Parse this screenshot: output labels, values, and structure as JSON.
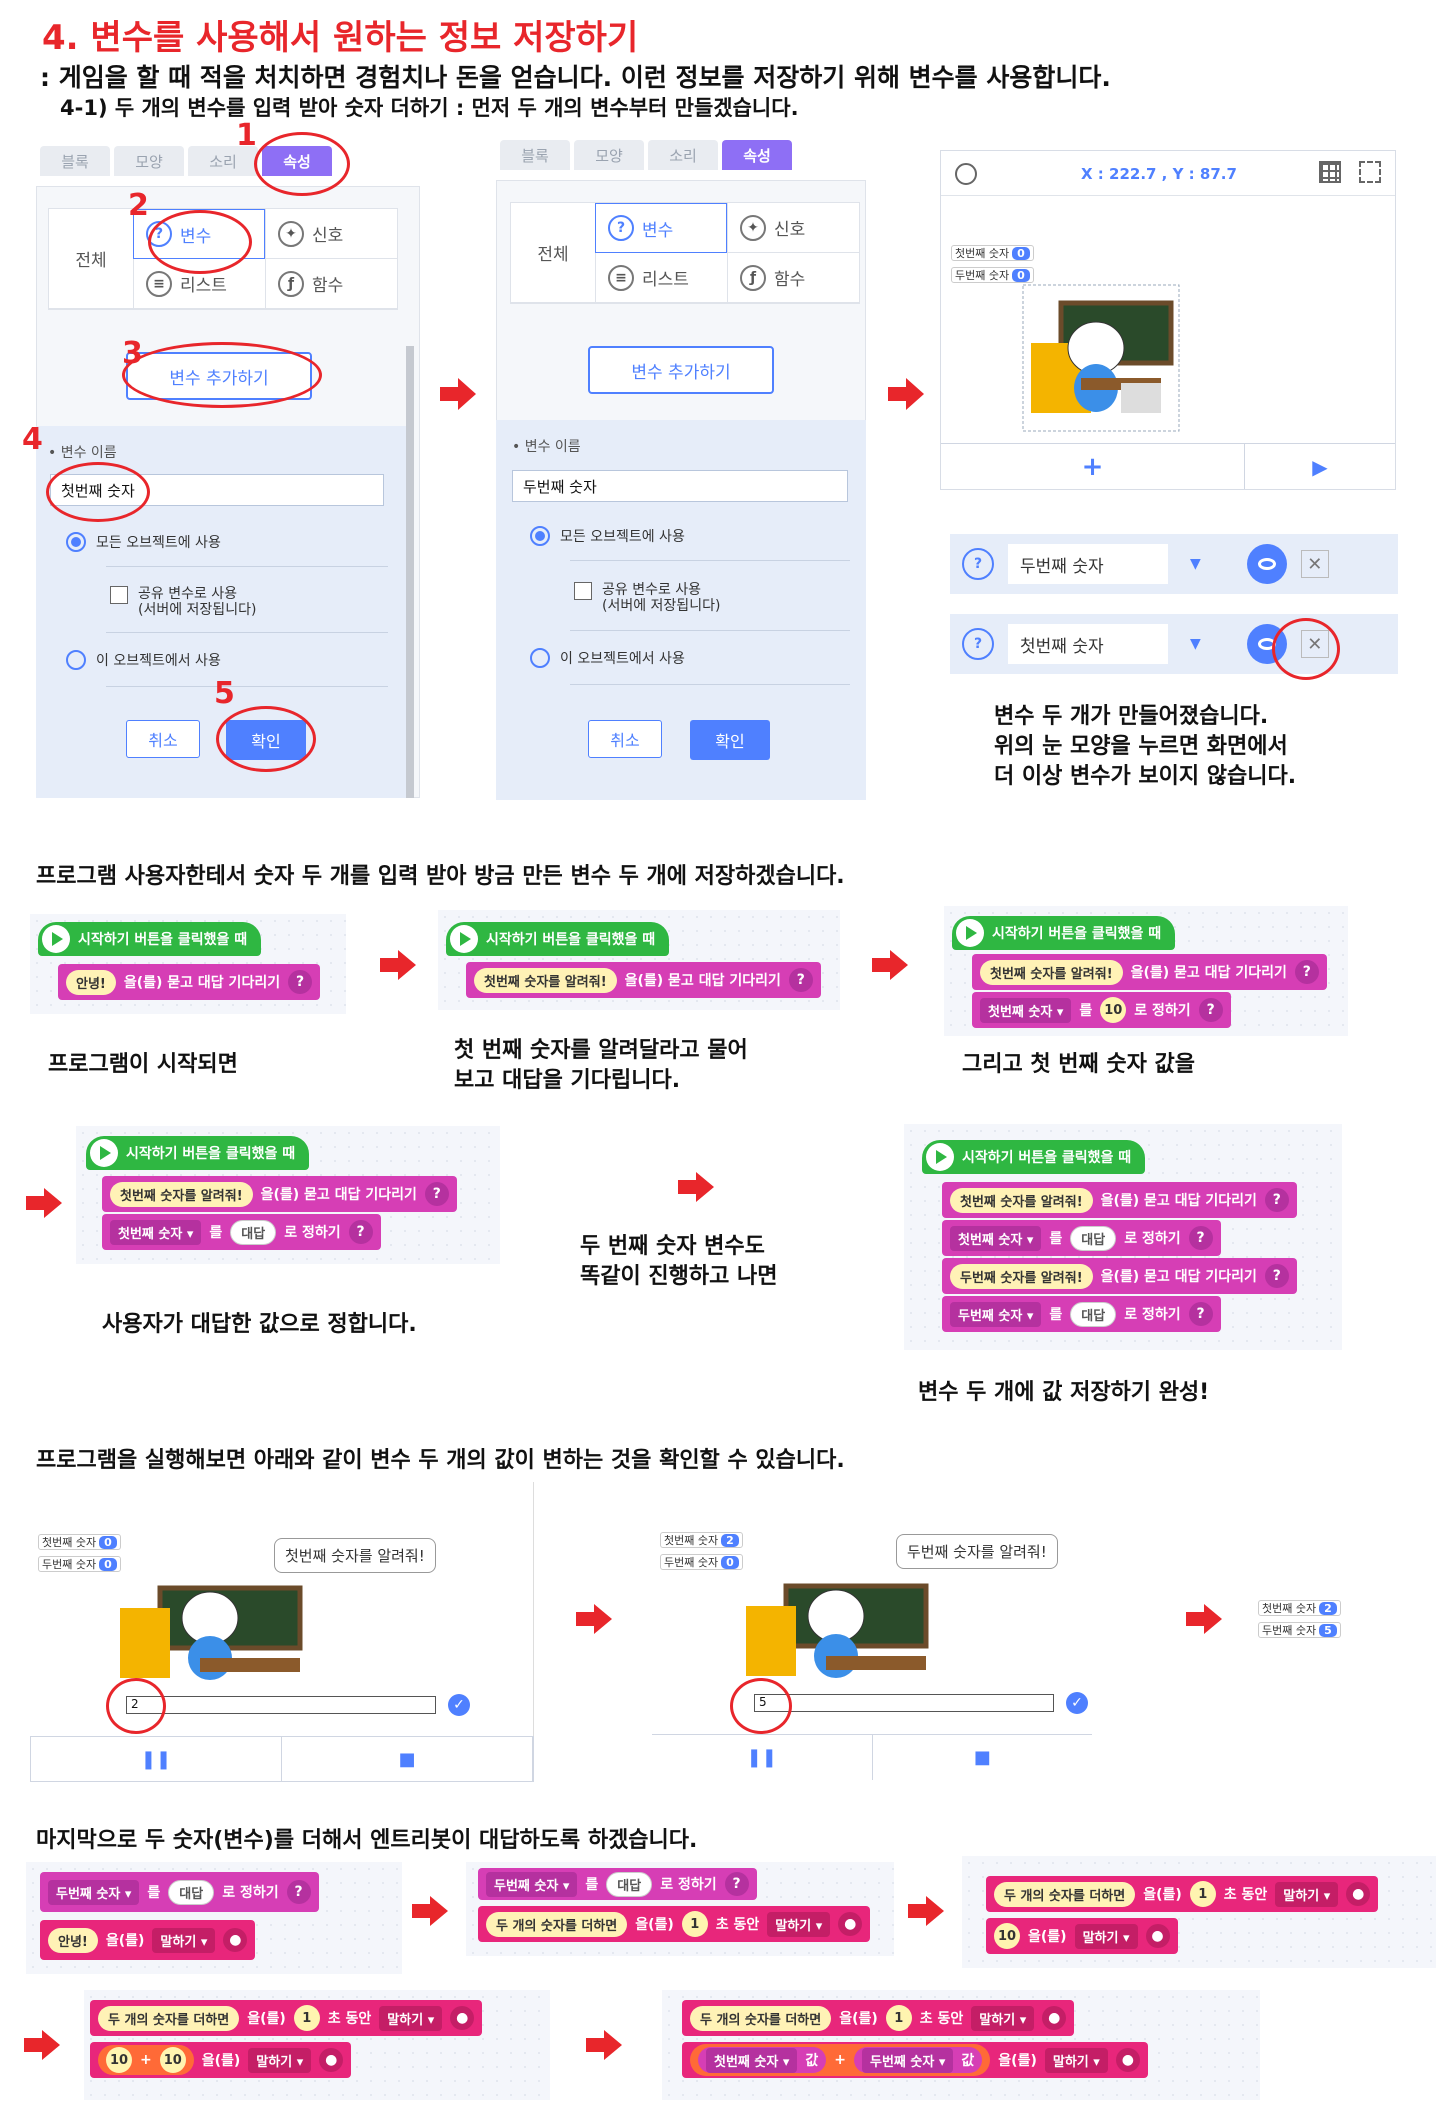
{
  "title": "4. 변수를 사용해서 원하는 정보 저장하기",
  "intro": ":  게임을 할 때 적을 처치하면 경험치나 돈을 얻습니다. 이런 정보를 저장하기 위해 변수를 사용합니다.",
  "sub": "4-1) 두 개의 변수를 입력 받아 숫자 더하기 : 먼저 두 개의 변수부터 만들겠습니다.",
  "panel": {
    "tabs": [
      "블록",
      "모양",
      "소리",
      "속성"
    ],
    "all": "전체",
    "var": "변수",
    "signal": "신호",
    "list": "리스트",
    "func": "함수",
    "add": "변수 추가하기",
    "name_label": "• 변수 이름",
    "name1": "첫번째 숫자",
    "name2": "두번째 숫자",
    "opt_all": "모든 오브젝트에 사용",
    "opt_share": "공유 변수로 사용",
    "opt_share2": "(서버에 저장됩니다)",
    "opt_this": "이 오브젝트에서 사용",
    "cancel": "취소",
    "ok": "확인"
  },
  "steps": [
    "1",
    "2",
    "3",
    "4",
    "5"
  ],
  "stage": {
    "coords": "X : 222.7 , Y : 87.7",
    "var1": "첫번째 숫자",
    "var2": "두번째 숫자",
    "v0": "0",
    "plus": "+",
    "play": "▶"
  },
  "varlist": {
    "row1": "두번째 숫자",
    "row2": "첫번째 숫자",
    "q": "?",
    "drop": "▼",
    "x": "✕"
  },
  "note1": "변수 두 개가 만들어졌습니다.",
  "note2": "위의 눈 모양을 누르면 화면에서",
  "note3": "더 이상 변수가 보이지 않습니다.",
  "section2": "프로그램 사용자한테서 숫자 두 개를 입력 받아 방금 만든 변수 두 개에 저장하겠습니다.",
  "blocks": {
    "start": "시작하기 버튼을 클릭했을 때",
    "hello": "안녕!",
    "ask": "을(를) 묻고 대답 기다리기",
    "tell_first": "첫번째 숫자를 알려줘!",
    "tell_second": "두번째 숫자를 알려줘!",
    "first": "첫번째 숫자 ▾",
    "second": "두번째 숫자 ▾",
    "to": "를",
    "set": "로 정하기",
    "ten": "10",
    "answer": "대답",
    "q": "?"
  },
  "cap1": "프로그램이 시작되면",
  "cap2a": "첫 번째 숫자를 알려달라고 물어",
  "cap2b": "보고 대답을 기다립니다.",
  "cap3": "그리고 첫 번째 숫자 값을",
  "cap4": "사용자가 대답한 값으로 정합니다.",
  "cap5a": "두 번째 숫자 변수도",
  "cap5b": "똑같이 진행하고 나면",
  "cap6": "변수 두 개에 값 저장하기 완성!",
  "section3": "프로그램을 실행해보면 아래와 같이 변수 두 개의 값이 변하는 것을 확인할 수 있습니다.",
  "run": {
    "bubble1": "첫번째 숫자를 알려줘!",
    "bubble2": "두번째 숫자를 알려줘!",
    "in1": "2",
    "in2": "5",
    "v2": "2",
    "v5": "5",
    "pause": "❚❚",
    "stop": "■",
    "check": "✓"
  },
  "section4": "마지막으로 두 숫자(변수)를 더해서 엔트리봇이 대답하도록 하겠습니다.",
  "last": {
    "sum": "두 개의 숫자를 더하면",
    "eul": "을(를)",
    "one": "1",
    "sec": "초 동안",
    "say": "말하기 ▾",
    "say2": "말하기 ▾",
    "hello": "안녕!",
    "ten": "10",
    "plus": "+",
    "first_val": "첫번째 숫자 ▾",
    "second_val": "두번째 숫자 ▾",
    "val": "값"
  }
}
